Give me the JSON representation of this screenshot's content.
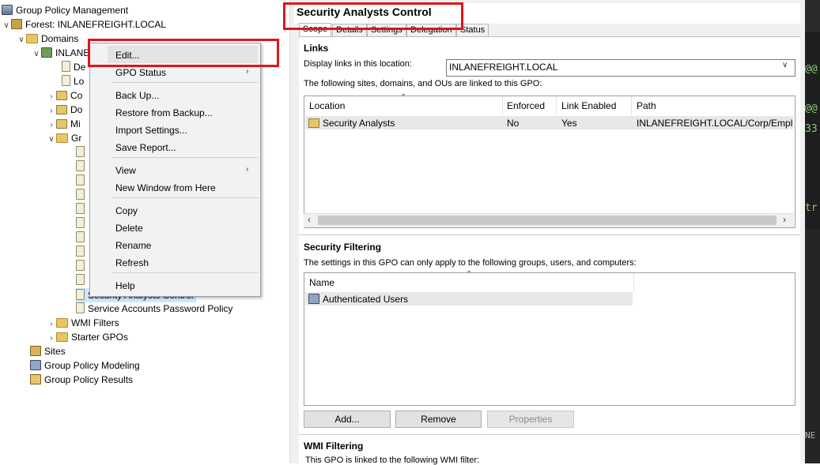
{
  "tree": {
    "root": "Group Policy Management",
    "forest": "Forest: INLANEFREIGHT.LOCAL",
    "domains": "Domains",
    "domain": "INLANE",
    "children_partial": [
      "De",
      "Lo",
      "Co",
      "Do",
      "Mi",
      "Gr"
    ],
    "gpo_selected": "Security Analysts Control",
    "gpo_next": "Service Accounts Password Policy",
    "wmi": "WMI Filters",
    "starter": "Starter GPOs",
    "sites": "Sites",
    "modeling": "Group Policy Modeling",
    "results": "Group Policy Results"
  },
  "context_menu": {
    "items": [
      "Edit...",
      "GPO Status",
      "Back Up...",
      "Restore from Backup...",
      "Import Settings...",
      "Save Report...",
      "View",
      "New Window from Here",
      "Copy",
      "Delete",
      "Rename",
      "Refresh",
      "Help"
    ]
  },
  "gpo": {
    "title": "Security Analysts Control",
    "tabs": [
      "Scope",
      "Details",
      "Settings",
      "Delegation",
      "Status"
    ],
    "links": {
      "heading": "Links",
      "display_label": "Display links in this location:",
      "location_value": "INLANEFREIGHT.LOCAL",
      "desc": "The following sites, domains, and OUs are linked to this GPO:",
      "columns": [
        "Location",
        "Enforced",
        "Link Enabled",
        "Path"
      ],
      "row": {
        "location": "Security Analysts",
        "enforced": "No",
        "enabled": "Yes",
        "path": "INLANEFREIGHT.LOCAL/Corp/Employee"
      }
    },
    "security": {
      "heading": "Security Filtering",
      "desc": "The settings in this GPO can only apply to the following groups, users, and computers:",
      "column": "Name",
      "entry": "Authenticated Users",
      "buttons": {
        "add": "Add...",
        "remove": "Remove",
        "properties": "Properties"
      }
    },
    "wmi": {
      "heading": "WMI Filtering",
      "desc": "This GPO is linked to the following WMI filter:"
    }
  },
  "terminal": {
    "lines": [
      "@@",
      "@@",
      "33",
      "tr",
      "NE"
    ]
  }
}
